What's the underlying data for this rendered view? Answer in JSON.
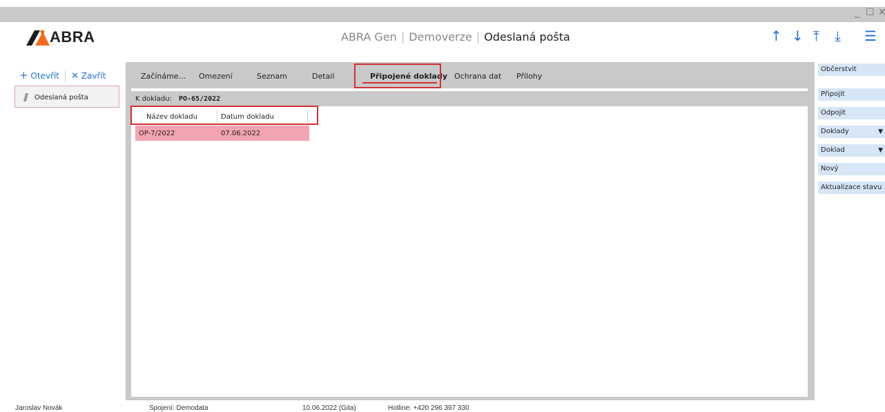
{
  "window": {
    "minimize": "_",
    "maximize": "☐",
    "close": "✕"
  },
  "header": {
    "logo_text": "ABRA",
    "app_name": "ABRA Gen",
    "edition": "Demoverze",
    "module": "Odeslaná pošta",
    "icons": [
      "arrow-up-icon",
      "arrow-down-icon",
      "arrow-to-top-icon",
      "arrow-to-bottom-icon",
      "menu-icon"
    ],
    "accent_color": "#1f6fd6"
  },
  "left": {
    "open_label": "Otevřít",
    "close_label": "Zavřít",
    "items": [
      {
        "label": "Odeslaná pošta"
      }
    ]
  },
  "tabs": [
    {
      "label": "Začínáme..."
    },
    {
      "label": "Omezení"
    },
    {
      "label": "Seznam"
    },
    {
      "label": "Detail"
    },
    {
      "label": "Připojené doklady",
      "active": true
    },
    {
      "label": "Ochrana dat"
    },
    {
      "label": "Přílohy"
    }
  ],
  "main": {
    "k_dokladu_label": "K dokladu:",
    "k_dokladu_value": "PO-65/2022",
    "table": {
      "columns": [
        "Název dokladu",
        "Datum dokladu"
      ],
      "rows": [
        {
          "nazev": "OP-7/2022",
          "datum": "07.06.2022",
          "selected": true
        }
      ]
    },
    "highlight_color": "#d32f2f",
    "selected_row_color": "#f4a4b0"
  },
  "actions": [
    {
      "label": "Občerstvit"
    },
    {
      "label": "Připojit"
    },
    {
      "label": "Odpojit"
    },
    {
      "label": "Doklady",
      "dropdown": true
    },
    {
      "label": "Doklad",
      "dropdown": true
    },
    {
      "label": "Nový"
    },
    {
      "label": "Aktualizace stavu"
    }
  ],
  "status": {
    "user": "Jaroslav Novák",
    "connection": "Spojení: Demodata",
    "date": "10.06.2022 (Gita)",
    "hotline": "Hotline: +420 296 397 330"
  }
}
